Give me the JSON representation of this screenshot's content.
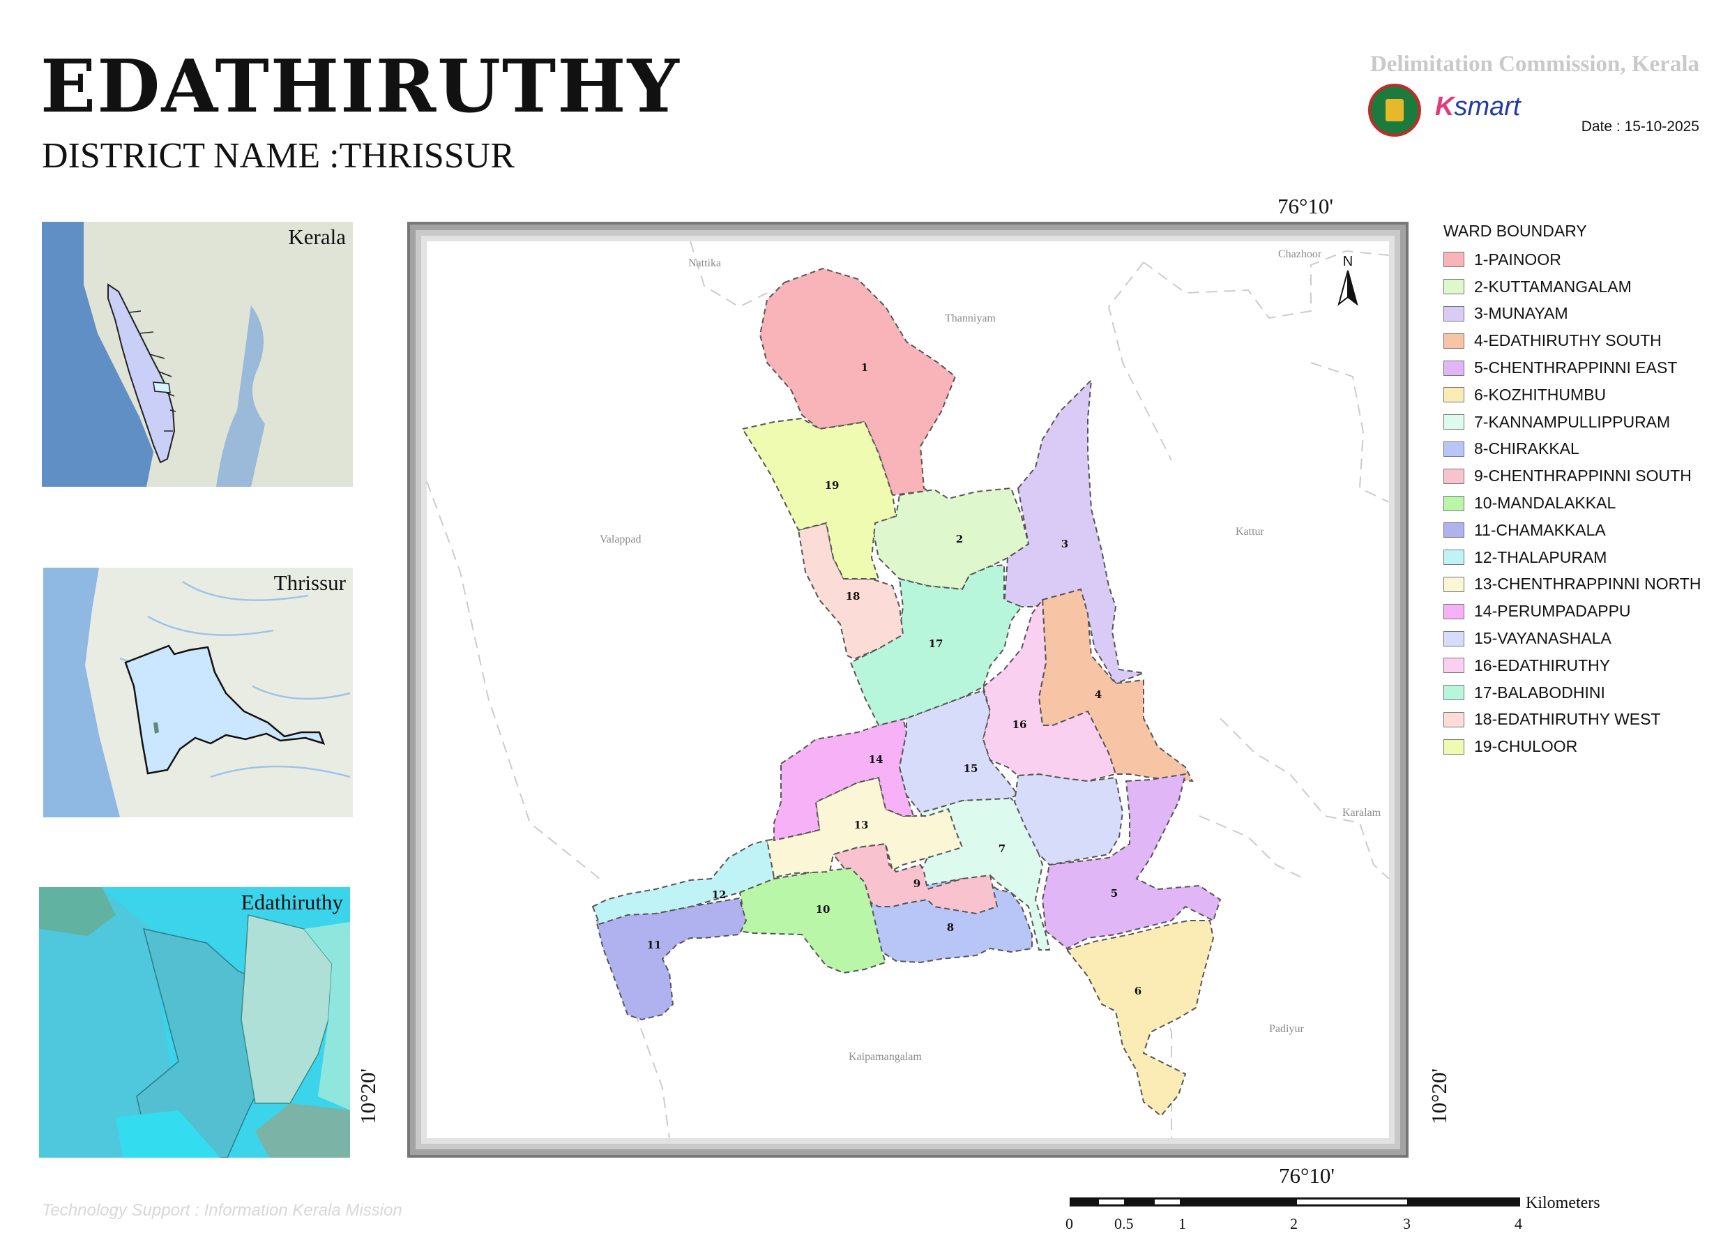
{
  "header": {
    "title": "EDATHIRUTHY",
    "district": "DISTRICT NAME :THRISSUR",
    "commission": "Delimitation Commission, Kerala",
    "date": "Date : 15-10-2025",
    "logo_right": {
      "prefix": "K",
      "rest": "smart"
    }
  },
  "insets": {
    "kerala_label": "Kerala",
    "thrissur_label": "Thrissur",
    "local_label": "Edathiruthy"
  },
  "map": {
    "coords": {
      "top_lon": "76°10'",
      "bottom_lon": "76°10'",
      "left_lat": "10°20'",
      "right_lat": "10°20'"
    },
    "north": "N",
    "neighbours": {
      "nattika": "Nattika",
      "thanniyam": "Thanniyam",
      "chazhoor": "Chazhoor",
      "valappad": "Valappad",
      "kattur": "Kattur",
      "karalam": "Karalam",
      "padiyur": "Padiyur",
      "kaipamangalam": "Kaipamangalam"
    },
    "ward_numbers": [
      "1",
      "2",
      "3",
      "4",
      "5",
      "6",
      "7",
      "8",
      "9",
      "10",
      "11",
      "12",
      "13",
      "14",
      "15",
      "16",
      "17",
      "18",
      "19"
    ]
  },
  "legend": {
    "title": "WARD BOUNDARY",
    "items": [
      {
        "label": "1-PAINOOR",
        "color": "#f8b4b8"
      },
      {
        "label": "2-KUTTAMANGALAM",
        "color": "#dff7cd"
      },
      {
        "label": "3-MUNAYAM",
        "color": "#dacbf6"
      },
      {
        "label": "4-EDATHIRUTHY SOUTH",
        "color": "#f8c4a6"
      },
      {
        "label": "5-CHENTHRAPPINNI EAST",
        "color": "#e1b6f6"
      },
      {
        "label": "6-KOZHITHUMBU",
        "color": "#fbebb4"
      },
      {
        "label": "7-KANNAMPULLIPPURAM",
        "color": "#ddfaee"
      },
      {
        "label": "8-CHIRAKKAL",
        "color": "#b7c6f6"
      },
      {
        "label": "9-CHENTHRAPPINNI SOUTH",
        "color": "#f9c2cf"
      },
      {
        "label": "10-MANDALAKKAL",
        "color": "#b9f6a8"
      },
      {
        "label": "11-CHAMAKKALA",
        "color": "#b0b2f0"
      },
      {
        "label": "12-THALAPURAM",
        "color": "#bff3f6"
      },
      {
        "label": "13-CHENTHRAPPINNI NORTH",
        "color": "#fbf6d6"
      },
      {
        "label": "14-PERUMPADAPPU",
        "color": "#f7b1f6"
      },
      {
        "label": "15-VAYANASHALA",
        "color": "#d6dcf9"
      },
      {
        "label": "16-EDATHIRUTHY",
        "color": "#fad0f0"
      },
      {
        "label": "17-BALABODHINI",
        "color": "#b8f6dc"
      },
      {
        "label": "18-EDATHIRUTHY WEST",
        "color": "#fbdcd6"
      },
      {
        "label": "19-CHULOOR",
        "color": "#eefbb0"
      }
    ]
  },
  "scale": {
    "ticks": [
      "0",
      "0.5",
      "1",
      "2",
      "3",
      "4"
    ],
    "unit": "Kilometers"
  },
  "footer": {
    "credit": "Technology Support : Information Kerala Mission"
  }
}
